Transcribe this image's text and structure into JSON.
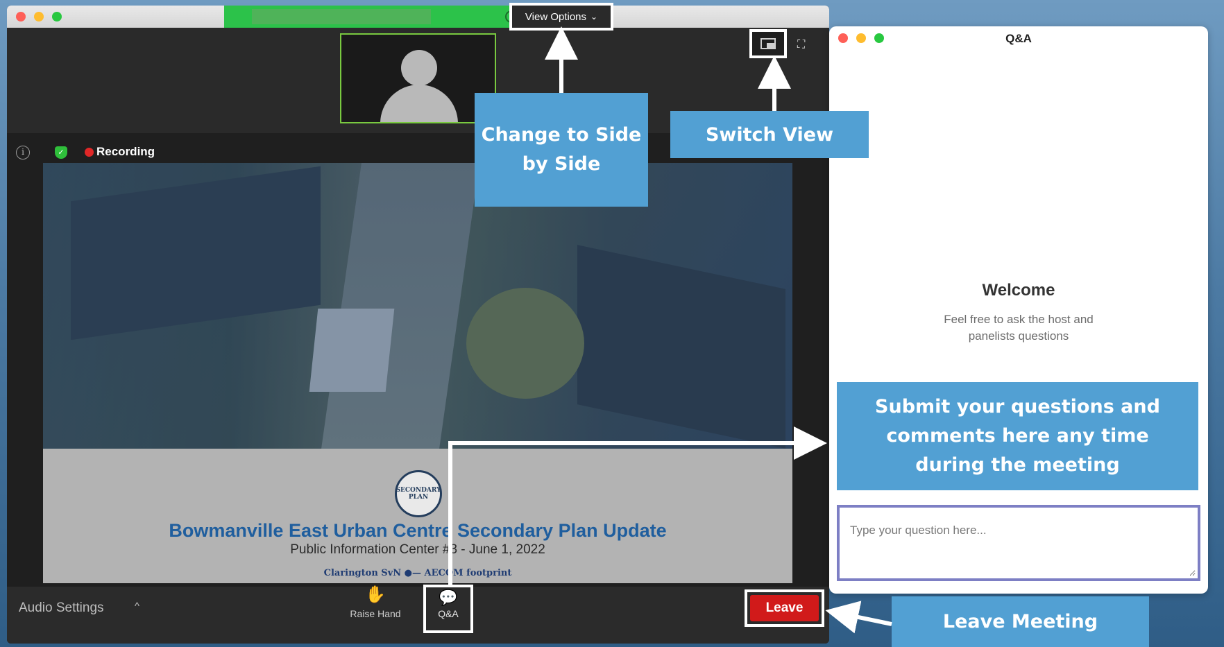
{
  "zoom": {
    "view_options_label": "View Options",
    "view_options_caret": "⌄",
    "recording_label": "Recording",
    "audio_settings_label": "Audio Settings",
    "audio_caret": "^",
    "raise_hand_label": "Raise Hand",
    "qa_button_label": "Q&A",
    "leave_label": "Leave"
  },
  "slide": {
    "logo_text": "SECONDARY PLAN",
    "title": "Bowmanville East Urban Centre Secondary Plan Update",
    "subtitle": "Public Information Center #3 - June 1, 2022",
    "partners": "Clarington  SvN  ●— AECOM   footprint"
  },
  "qa_window": {
    "title": "Q&A",
    "welcome": "Welcome",
    "description": "Feel free to ask the host and panelists questions",
    "input_placeholder": "Type your question here..."
  },
  "callouts": {
    "side_by_side": "Change to Side by Side",
    "switch_view": "Switch View",
    "submit": "Submit your questions and comments here any time during the meeting",
    "leave_meeting": "Leave Meeting"
  },
  "colors": {
    "callout_blue": "#52a0d3",
    "leave_red": "#d11a1a",
    "share_green": "#2cc24a",
    "slide_title_blue": "#1f5e9e",
    "qa_input_border": "#7d7fc4"
  }
}
